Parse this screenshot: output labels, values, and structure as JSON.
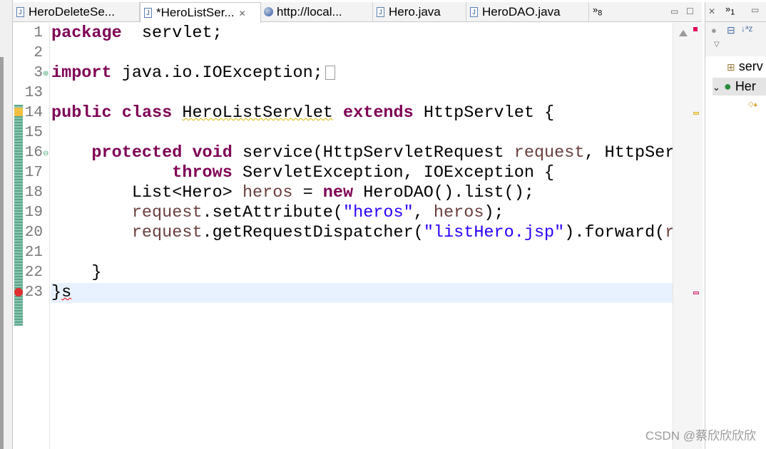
{
  "tabs": [
    {
      "label": "HeroDeleteSe...",
      "icon": "java-file-warning-icon",
      "active": false
    },
    {
      "label": "*HeroListSer...",
      "icon": "java-file-warning-icon",
      "active": true
    },
    {
      "label": "http://local...",
      "icon": "globe-icon",
      "active": false
    },
    {
      "label": "Hero.java",
      "icon": "java-file-icon",
      "active": false
    },
    {
      "label": "HeroDAO.java",
      "icon": "java-file-icon",
      "active": false
    }
  ],
  "overflow_count": "8",
  "close_glyph": "✕",
  "editor": {
    "lines": [
      {
        "n": "1",
        "tokens": [
          [
            "kw",
            "package"
          ],
          [
            "",
            "  servlet;"
          ]
        ]
      },
      {
        "n": "2",
        "tokens": []
      },
      {
        "n": "3",
        "tokens": [
          [
            "kw",
            "import"
          ],
          [
            "",
            " java.io.IOException;"
          ]
        ],
        "folded": true
      },
      {
        "n": "13",
        "tokens": []
      },
      {
        "n": "14",
        "tokens": [
          [
            "kw",
            "public"
          ],
          [
            "",
            " "
          ],
          [
            "kw",
            "class"
          ],
          [
            "",
            " "
          ],
          [
            "warnu",
            "HeroListServlet"
          ],
          [
            "",
            " "
          ],
          [
            "kw",
            "extends"
          ],
          [
            "",
            " HttpServlet {"
          ]
        ]
      },
      {
        "n": "15",
        "tokens": []
      },
      {
        "n": "16",
        "tokens": [
          [
            "",
            "    "
          ],
          [
            "kw",
            "protected"
          ],
          [
            "",
            " "
          ],
          [
            "kw",
            "void"
          ],
          [
            "",
            " service(HttpServletRequest "
          ],
          [
            "var",
            "request"
          ],
          [
            "",
            ", HttpServ"
          ]
        ]
      },
      {
        "n": "17",
        "tokens": [
          [
            "",
            "            "
          ],
          [
            "kw",
            "throws"
          ],
          [
            "",
            " ServletException, IOException {"
          ]
        ]
      },
      {
        "n": "18",
        "tokens": [
          [
            "",
            "        List<Hero> "
          ],
          [
            "var",
            "heros"
          ],
          [
            "",
            " = "
          ],
          [
            "kw",
            "new"
          ],
          [
            "",
            " HeroDAO().list();"
          ]
        ]
      },
      {
        "n": "19",
        "tokens": [
          [
            "",
            "        "
          ],
          [
            "var",
            "request"
          ],
          [
            "",
            ".setAttribute("
          ],
          [
            "str",
            "\"heros\""
          ],
          [
            "",
            ", "
          ],
          [
            "var",
            "heros"
          ],
          [
            "",
            ");"
          ]
        ]
      },
      {
        "n": "20",
        "tokens": [
          [
            "",
            "        "
          ],
          [
            "var",
            "request"
          ],
          [
            "",
            ".getRequestDispatcher("
          ],
          [
            "str",
            "\"listHero.jsp\""
          ],
          [
            "",
            ").forward("
          ],
          [
            "var",
            "re"
          ]
        ]
      },
      {
        "n": "21",
        "tokens": []
      },
      {
        "n": "22",
        "tokens": [
          [
            "",
            "    }"
          ]
        ]
      },
      {
        "n": "23",
        "tokens": [
          [
            "",
            "}"
          ],
          [
            "erru",
            "s"
          ]
        ]
      }
    ]
  },
  "outline": {
    "overflow_count": "1",
    "items": [
      {
        "label": "serv"
      },
      {
        "label": "Her"
      }
    ]
  },
  "watermark": "CSDN @蔡欣欣欣欣",
  "colors": {
    "keyword": "#7f0055",
    "string": "#2a00ff",
    "variable": "#6a3e3e",
    "current_line": "#e8f2fe",
    "error": "#e0005a"
  }
}
